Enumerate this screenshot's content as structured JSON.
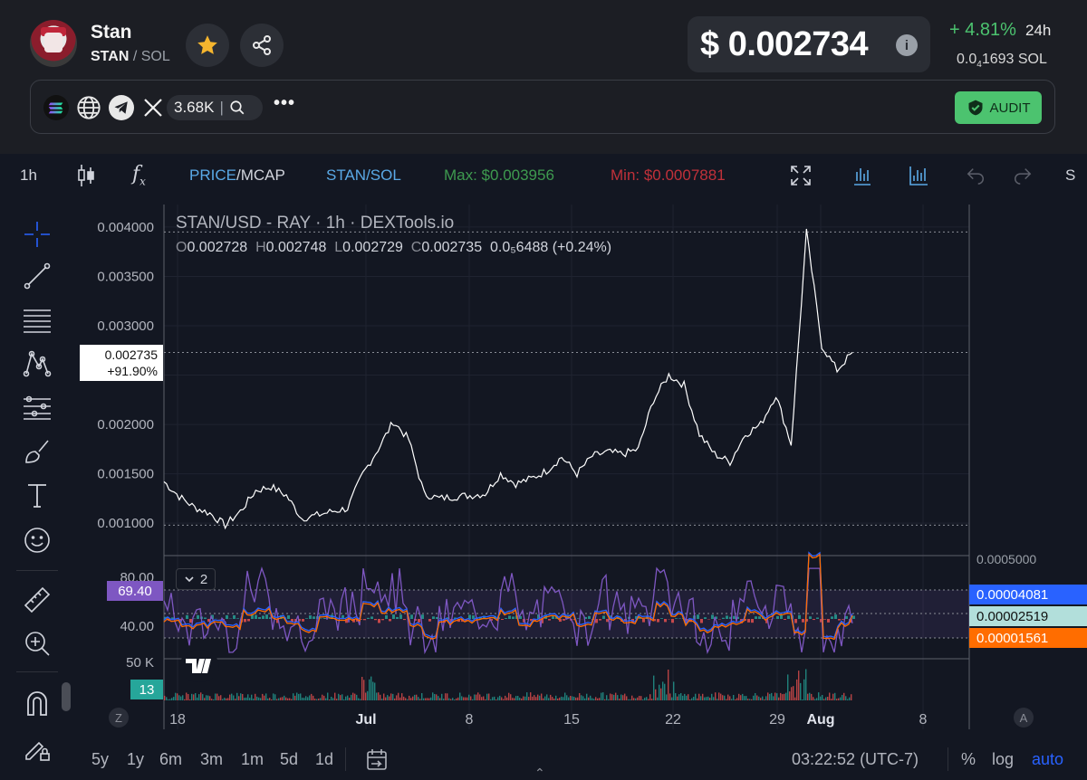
{
  "token": {
    "name": "Stan",
    "symbol": "STAN",
    "quote": "SOL"
  },
  "price": {
    "usd": "$ 0.002734",
    "change": "+ 4.81%",
    "period": "24h",
    "sol_main": "0.0",
    "sol_sub": "4",
    "sol_rest": "1693 SOL"
  },
  "links": {
    "x_followers": "3.68K",
    "more": "•••",
    "audit_label": "AUDIT"
  },
  "toolbar": {
    "interval": "1h",
    "price_label": "PRICE",
    "mcap_label": "/MCAP",
    "pair_label": "STAN/SOL",
    "max_label": "Max: $0.003956",
    "min_label": "Min: $0.0007881",
    "overflow": "S"
  },
  "chart": {
    "legend_title": "STAN/USD - RAY · 1h · DEXTools.io",
    "ohlc": {
      "o_k": "O",
      "o": "0.002728",
      "h_k": "H",
      "h": "0.002748",
      "l_k": "L",
      "l": "0.002729",
      "c_k": "C",
      "c": "0.002735",
      "vol": "0.0₅6488 (+0.24%)"
    },
    "current_price_tag": "0.002735",
    "current_change_tag": "+91.90%",
    "rsi_value_tag": "69.40",
    "indicator_count": "2",
    "volume_tag": "13",
    "right_scale_top": "0.0005000",
    "right_tags": [
      "0.00004081",
      "0.00002519",
      "0.00001561"
    ],
    "left_indicator_ticks": [
      "80.00",
      "40.00"
    ],
    "volume_tick": "50 K",
    "z_label": "Z",
    "a_label": "A"
  },
  "chart_data": {
    "type": "line",
    "title": "STAN/USD - RAY · 1h · DEXTools.io",
    "ylim": [
      0.0008,
      0.0041
    ],
    "y_ticks": [
      "0.004000",
      "0.003500",
      "0.003000",
      "0.002500",
      "0.002000",
      "0.001500",
      "0.001000"
    ],
    "x_ticks": [
      "18",
      "Jul",
      "8",
      "15",
      "22",
      "29",
      "Aug",
      "8"
    ],
    "series": [
      {
        "x": [
          "Jun 18",
          "Jun 19",
          "Jun 20",
          "Jun 21",
          "Jun 22",
          "Jun 23",
          "Jun 24",
          "Jun 25",
          "Jun 26",
          "Jun 27",
          "Jun 28",
          "Jun 29",
          "Jun 30",
          "Jul 1",
          "Jul 2",
          "Jul 3",
          "Jul 4",
          "Jul 5",
          "Jul 6",
          "Jul 7",
          "Jul 8",
          "Jul 9",
          "Jul 10",
          "Jul 11",
          "Jul 12",
          "Jul 13",
          "Jul 14",
          "Jul 15",
          "Jul 16",
          "Jul 17",
          "Jul 18",
          "Jul 19",
          "Jul 20",
          "Jul 21",
          "Jul 22",
          "Jul 23",
          "Jul 24",
          "Jul 25",
          "Jul 26",
          "Jul 27",
          "Jul 28",
          "Jul 29",
          "Jul 30",
          "Jul 31",
          "Aug 1",
          "Aug 2"
        ],
        "y": [
          0.00142,
          0.00127,
          0.00116,
          0.0011,
          0.00098,
          0.00112,
          0.00133,
          0.00137,
          0.00128,
          0.00105,
          0.00108,
          0.00112,
          0.00115,
          0.0015,
          0.00175,
          0.00203,
          0.00185,
          0.0013,
          0.00125,
          0.00127,
          0.00128,
          0.0013,
          0.0015,
          0.0014,
          0.00145,
          0.00153,
          0.00167,
          0.0015,
          0.00168,
          0.00172,
          0.0017,
          0.00175,
          0.00225,
          0.0025,
          0.0024,
          0.0019,
          0.0017,
          0.00162,
          0.0019,
          0.002,
          0.0023,
          0.0018,
          0.00395,
          0.0028,
          0.00255,
          0.00273
        ]
      }
    ],
    "rsi": {
      "levels": [
        70,
        30
      ],
      "current": 69.4
    },
    "indicator_right_values": [
      4.081e-05,
      2.519e-05,
      1.561e-05
    ],
    "colors": {
      "price_line": "#ffffff",
      "rsi": "#7e57c2",
      "macd": "#2962ff",
      "signal": "#ff6d00",
      "hist_up": "#26a69a",
      "hist_down": "#ef5350"
    }
  },
  "bottom": {
    "ranges": [
      "5y",
      "1y",
      "6m",
      "3m",
      "1m",
      "5d",
      "1d"
    ],
    "time": "03:22:52 (UTC-7)",
    "percent": "%",
    "log": "log",
    "auto": "auto"
  }
}
